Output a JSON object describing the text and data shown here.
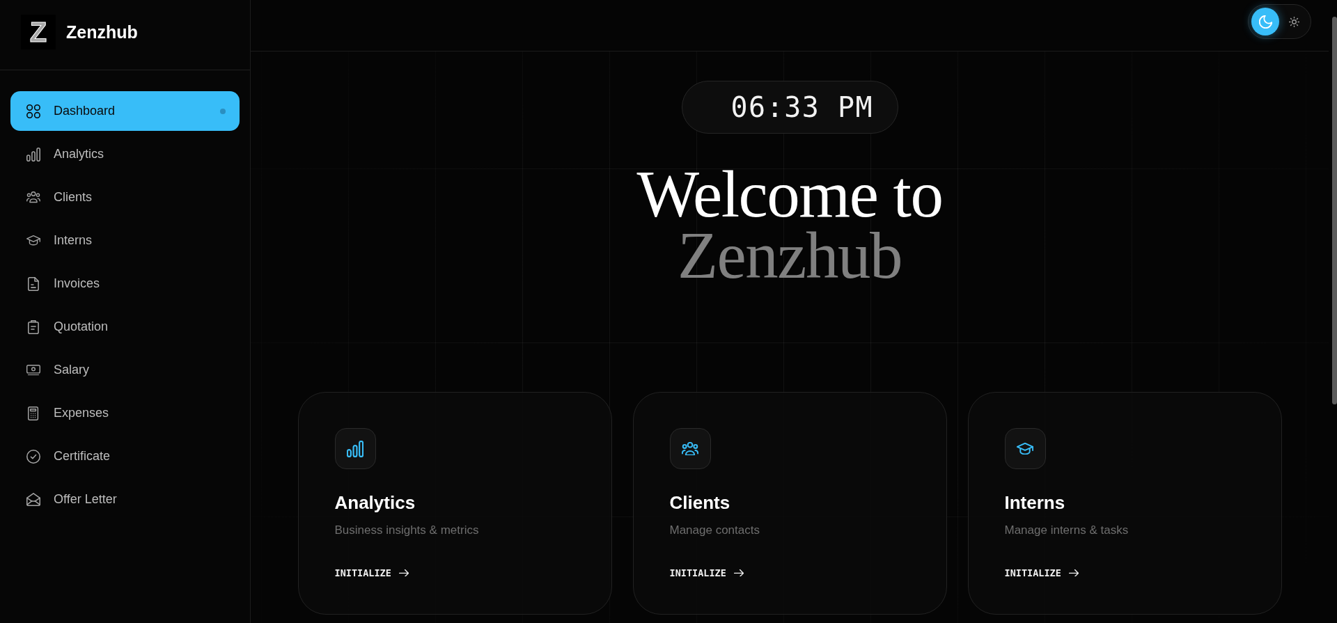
{
  "brand": {
    "logo_letter": "Z",
    "name": "Zenzhub"
  },
  "sidebar": {
    "items": [
      {
        "label": "Dashboard",
        "selected": true
      },
      {
        "label": "Analytics",
        "selected": false
      },
      {
        "label": "Clients",
        "selected": false
      },
      {
        "label": "Interns",
        "selected": false
      },
      {
        "label": "Invoices",
        "selected": false
      },
      {
        "label": "Quotation",
        "selected": false
      },
      {
        "label": "Salary",
        "selected": false
      },
      {
        "label": "Expenses",
        "selected": false
      },
      {
        "label": "Certificate",
        "selected": false
      },
      {
        "label": "Offer Letter",
        "selected": false
      }
    ]
  },
  "theme_toggle": {
    "options": [
      {
        "kind": "dark",
        "selected": true
      },
      {
        "kind": "light",
        "selected": false
      }
    ]
  },
  "clock": {
    "time": "06:33 PM"
  },
  "hero": {
    "line_1": "Welcome to",
    "line_2": "Zenzhub"
  },
  "cards": [
    {
      "title": "Analytics",
      "description": "Business insights & metrics",
      "action": "INITIALIZE"
    },
    {
      "title": "Clients",
      "description": "Manage contacts",
      "action": "INITIALIZE"
    },
    {
      "title": "Interns",
      "description": "Manage interns & tasks",
      "action": "INITIALIZE"
    }
  ]
}
